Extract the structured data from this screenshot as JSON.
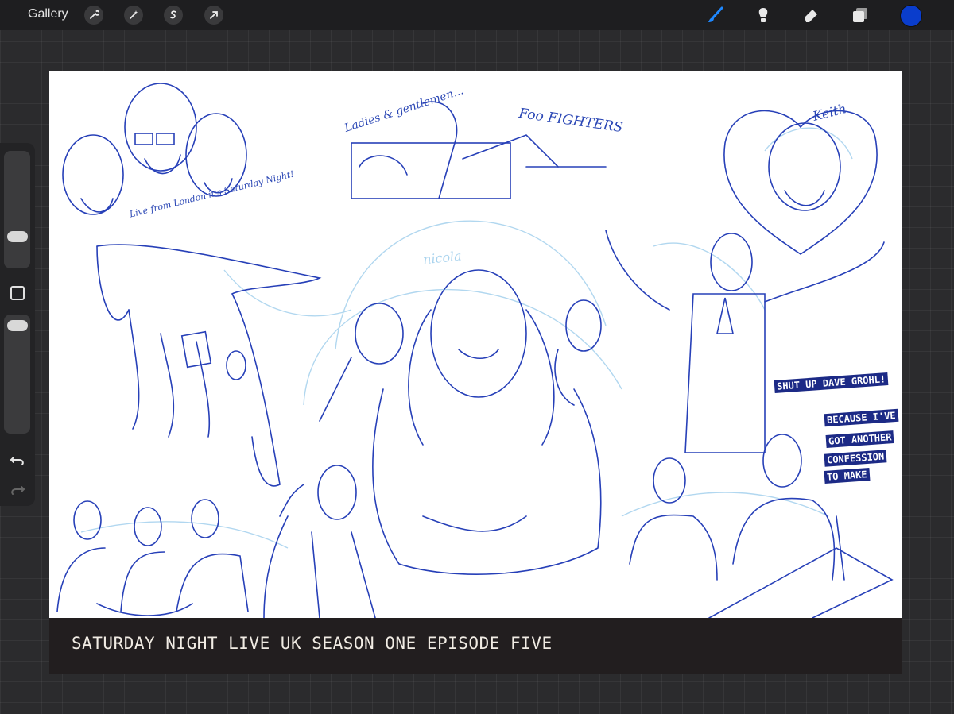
{
  "app": {
    "gallery_label": "Gallery",
    "toolbar_left": [
      "wrench-icon",
      "magic-wand-icon",
      "selection-s-icon",
      "move-arrow-icon"
    ],
    "toolbar_right": [
      "brush-icon",
      "smudge-icon",
      "eraser-icon",
      "layers-icon"
    ],
    "current_color": "#0a3dcc",
    "accent_color": "#1e88ff"
  },
  "sidebar": {
    "brush_size_slider": 0.25,
    "opacity_slider": 0.95
  },
  "canvas": {
    "banner_text": "SATURDAY NIGHT LIVE UK  SEASON ONE EPISODE FIVE",
    "sketch_texts": {
      "foo_fighters": "Foo FIGHTERS",
      "ladies": "Ladies & gentlemen...",
      "live_from_london": "Live from London it's Saturday Night!",
      "keith": "Keith",
      "nicola": "nicola",
      "shut_up": "SHUT UP DAVE GROHL!",
      "confession_1": "BECAUSE I'VE",
      "confession_2": "GOT ANOTHER",
      "confession_3": "CONFESSION",
      "confession_4": "TO MAKE"
    }
  }
}
